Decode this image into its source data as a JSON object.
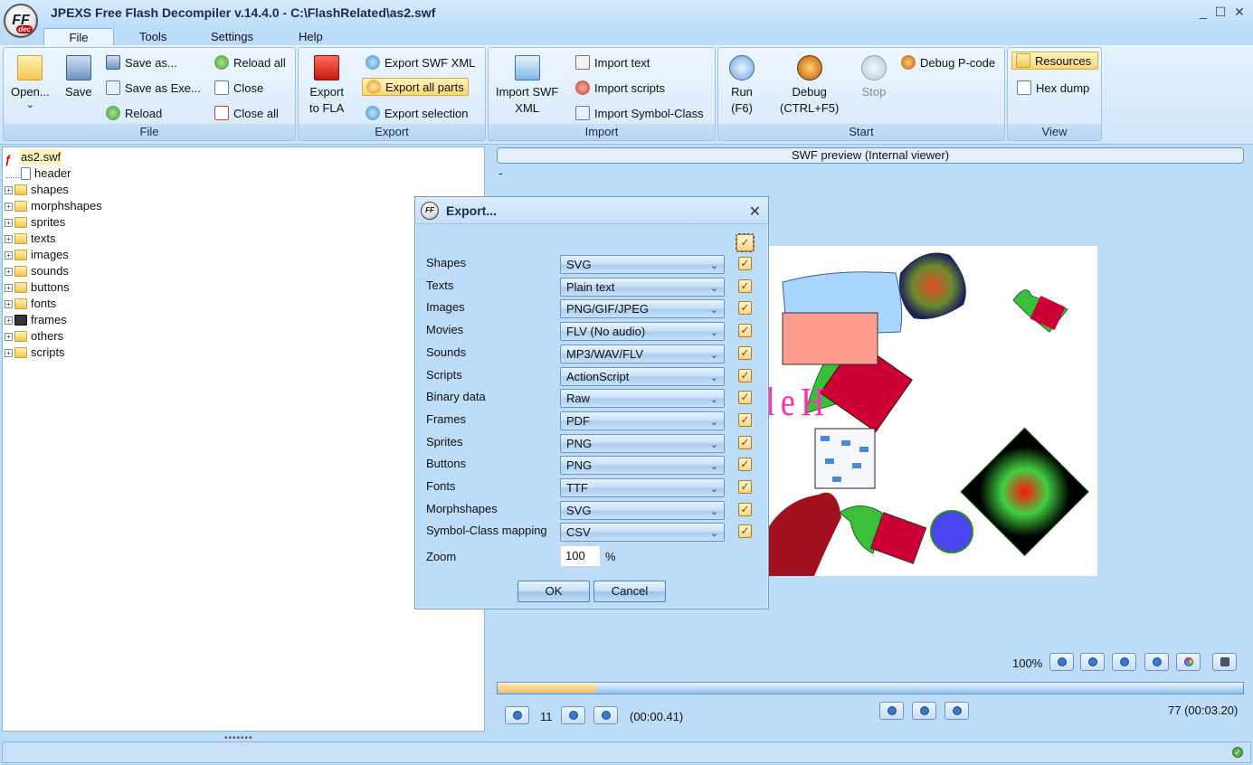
{
  "window": {
    "title": "JPEXS Free Flash Decompiler v.14.4.0 - C:\\FlashRelated\\as2.swf",
    "logo_text": "FF",
    "logo_sub": "dec"
  },
  "menu": {
    "tabs": [
      "File",
      "Tools",
      "Settings",
      "Help"
    ],
    "active": "File"
  },
  "ribbon": {
    "file": {
      "label": "File",
      "open": "Open...",
      "open_arrow": "⌄",
      "save": "Save",
      "save_as": "Save as...",
      "save_as_exe": "Save as Exe...",
      "reload": "Reload",
      "reload_all": "Reload all",
      "close": "Close",
      "close_all": "Close all"
    },
    "export": {
      "label": "Export",
      "export_fla_1": "Export",
      "export_fla_2": "to FLA",
      "export_swf_xml": "Export SWF XML",
      "export_all_parts": "Export all parts",
      "export_selection": "Export selection"
    },
    "import": {
      "label": "Import",
      "import_swf_xml_1": "Import SWF",
      "import_swf_xml_2": "XML",
      "import_text": "Import text",
      "import_scripts": "Import scripts",
      "import_symbol_class": "Import Symbol-Class"
    },
    "start": {
      "label": "Start",
      "run_1": "Run",
      "run_2": "(F6)",
      "debug_1": "Debug",
      "debug_2": "(CTRL+F5)",
      "stop": "Stop",
      "debug_pcode": "Debug P-code"
    },
    "view": {
      "label": "View",
      "resources": "Resources",
      "hex_dump": "Hex dump"
    }
  },
  "tree": {
    "root": "as2.swf",
    "items": [
      "header",
      "shapes",
      "morphshapes",
      "sprites",
      "texts",
      "images",
      "sounds",
      "buttons",
      "fonts",
      "frames",
      "others",
      "scripts"
    ]
  },
  "preview": {
    "header": "SWF preview (Internal viewer)",
    "dash": "-",
    "canvas_text": "HelloWorld",
    "zoom": "100%",
    "frame": "11",
    "time": "(00:00.41)",
    "total": "77 (00:03.20)",
    "progress_fraction": 0.13
  },
  "dialog": {
    "title": "Export...",
    "close": "✕",
    "check_mark": "✓",
    "options": [
      {
        "label": "Shapes",
        "value": "SVG"
      },
      {
        "label": "Texts",
        "value": "Plain text"
      },
      {
        "label": "Images",
        "value": "PNG/GIF/JPEG"
      },
      {
        "label": "Movies",
        "value": "FLV (No audio)"
      },
      {
        "label": "Sounds",
        "value": "MP3/WAV/FLV"
      },
      {
        "label": "Scripts",
        "value": "ActionScript"
      },
      {
        "label": "Binary data",
        "value": "Raw"
      },
      {
        "label": "Frames",
        "value": "PDF"
      },
      {
        "label": "Sprites",
        "value": "PNG"
      },
      {
        "label": "Buttons",
        "value": "PNG"
      },
      {
        "label": "Fonts",
        "value": "TTF"
      },
      {
        "label": "Morphshapes",
        "value": "SVG"
      },
      {
        "label": "Symbol-Class mapping",
        "value": "CSV"
      }
    ],
    "zoom_label": "Zoom",
    "zoom_value": "100",
    "zoom_unit": "%",
    "ok": "OK",
    "cancel": "Cancel"
  }
}
